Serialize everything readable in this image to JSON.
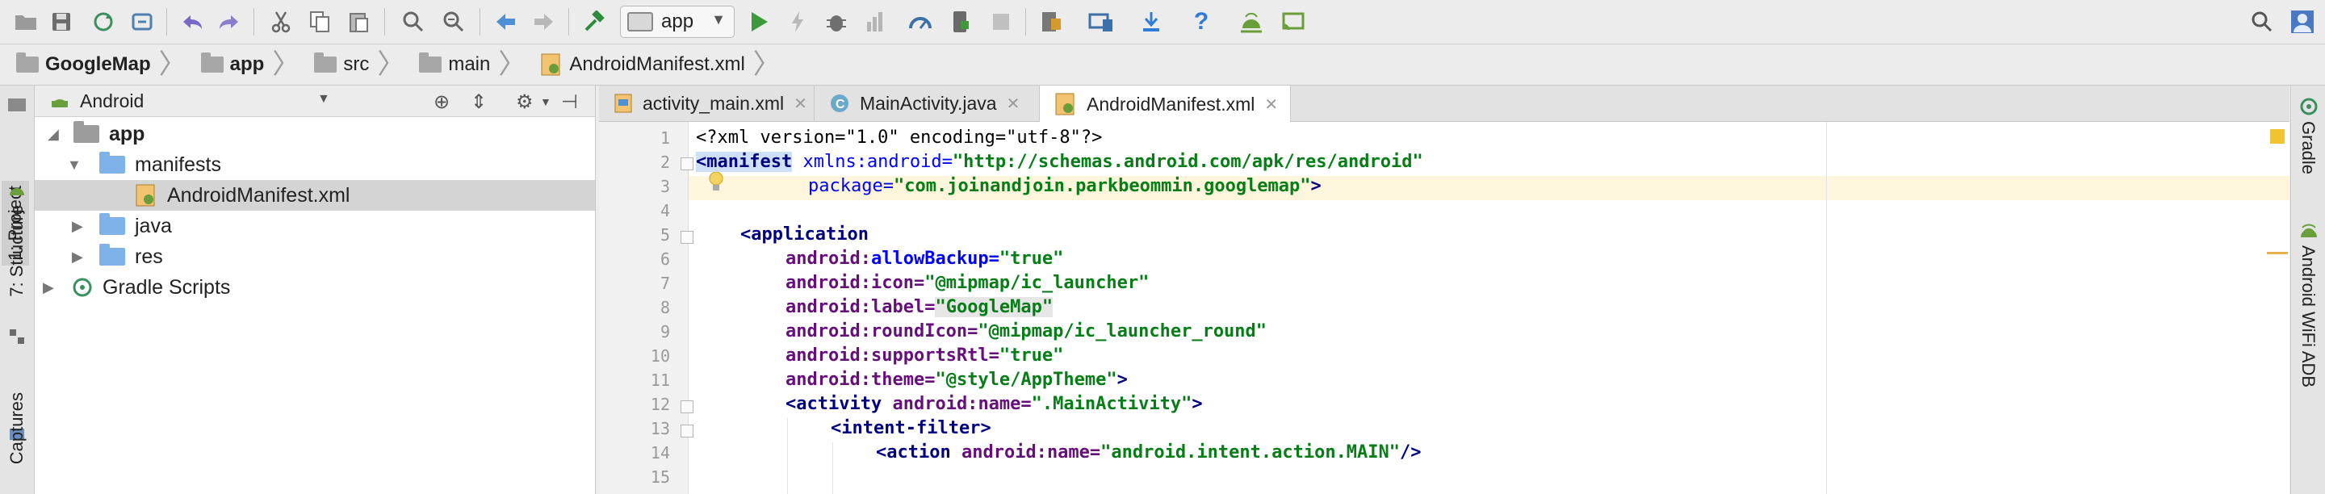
{
  "toolbar": {
    "run_config": "app",
    "icons": [
      "open-icon",
      "save-icon",
      "sync-icon",
      "refresh-icon",
      "undo-icon",
      "redo-icon",
      "cut-icon",
      "copy-icon",
      "paste-icon",
      "find-icon",
      "replace-icon",
      "back-icon",
      "forward-icon",
      "build-icon",
      "run-icon",
      "apply-changes-icon",
      "debug-icon",
      "profile-icon",
      "attach-debugger-icon",
      "stop-icon",
      "sdk-manager-icon",
      "device-manager-icon",
      "download-icon",
      "help-icon",
      "android-icon",
      "cast-icon",
      "search-icon",
      "user-icon"
    ],
    "colors": {
      "run": "#3c9a3c",
      "undo": "#7a68c9",
      "help": "#2f7bd8",
      "download": "#2f7bd8"
    }
  },
  "navbar": {
    "crumbs": [
      "GoogleMap",
      "app",
      "src",
      "main",
      "AndroidManifest.xml"
    ]
  },
  "left_strip": {
    "labels": [
      "1: Project",
      "7: Structure",
      "Captures"
    ]
  },
  "project_panel": {
    "view": "Android",
    "tree": [
      {
        "label": "app",
        "depth": 0,
        "expanded": true,
        "bold": true
      },
      {
        "label": "manifests",
        "depth": 1,
        "expanded": true
      },
      {
        "label": "AndroidManifest.xml",
        "depth": 2,
        "selected": true
      },
      {
        "label": "java",
        "depth": 1,
        "expanded": false
      },
      {
        "label": "res",
        "depth": 1,
        "expanded": false
      },
      {
        "label": "Gradle Scripts",
        "depth": 0,
        "expanded": false
      }
    ]
  },
  "editor": {
    "tabs": [
      {
        "label": "activity_main.xml",
        "active": false
      },
      {
        "label": "MainActivity.java",
        "active": false
      },
      {
        "label": "AndroidManifest.xml",
        "active": true
      }
    ],
    "line_numbers": [
      "1",
      "2",
      "3",
      "4",
      "5",
      "6",
      "7",
      "8",
      "9",
      "10",
      "11",
      "12",
      "13",
      "14",
      "15"
    ],
    "code": {
      "l1_a": "<?xml version=\"1.0\" encoding=\"utf-8\"?>",
      "l2_tag": "<manifest",
      "l2_attr": " xmlns:android=",
      "l2_val": "\"http://schemas.android.com/apk/res/android\"",
      "l3_attr": "package=",
      "l3_val": "\"com.joinandjoin.parkbeommin.googlemap\"",
      "l3_end": ">",
      "l5_tag": "<application",
      "l6_ns": "android:",
      "l6_attr": "allowBackup=",
      "l6_val": "\"true\"",
      "l7_attr": "icon=",
      "l7_val": "\"@mipmap/ic_launcher\"",
      "l8_attr": "label=",
      "l8_val": "\"GoogleMap\"",
      "l9_attr": "roundIcon=",
      "l9_val": "\"@mipmap/ic_launcher_round\"",
      "l10_attr": "supportsRtl=",
      "l10_val": "\"true\"",
      "l11_attr": "theme=",
      "l11_val": "\"@style/AppTheme\"",
      "l11_end": ">",
      "l12_tag": "<activity",
      "l12_attr": "name=",
      "l12_val": "\".MainActivity\"",
      "l12_end": ">",
      "l13_tag": "<intent-filter",
      "l13_end": ">",
      "l14_tag": "<action",
      "l14_attr": "name=",
      "l14_val": "\"android.intent.action.MAIN\"",
      "l14_end": "/>"
    }
  },
  "right_strip": {
    "labels": [
      "Gradle",
      "Android WiFi ADB"
    ]
  }
}
